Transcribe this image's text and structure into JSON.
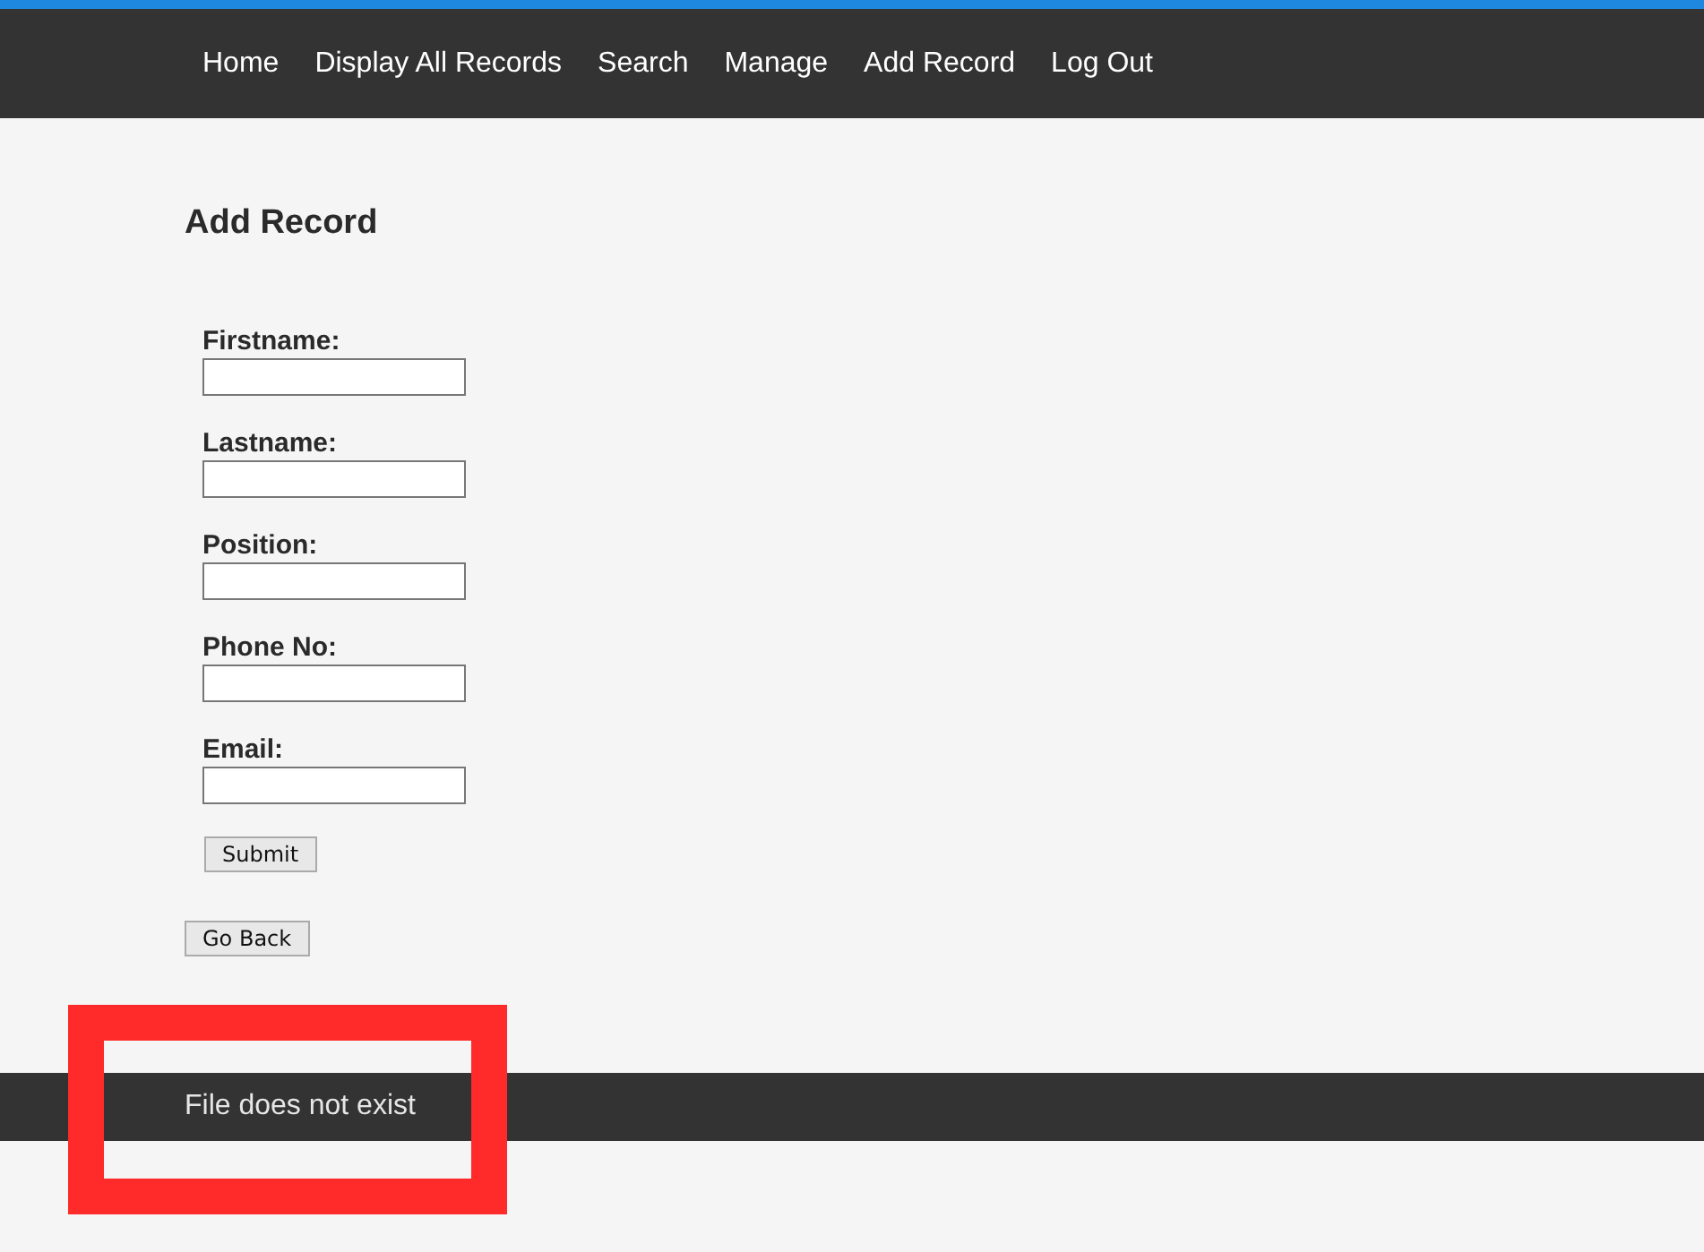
{
  "nav": {
    "links": [
      "Home",
      "Display All Records",
      "Search",
      "Manage",
      "Add Record",
      "Log Out"
    ]
  },
  "page": {
    "title": "Add Record",
    "form": {
      "fields": [
        {
          "label": "Firstname:"
        },
        {
          "label": "Lastname:"
        },
        {
          "label": "Position:"
        },
        {
          "label": "Phone No:"
        },
        {
          "label": "Email:"
        }
      ],
      "submit": "Submit"
    },
    "back_button": "Go Back"
  },
  "footer": {
    "message": "File does not exist"
  },
  "annotation": {
    "kind": "highlight-frame"
  }
}
